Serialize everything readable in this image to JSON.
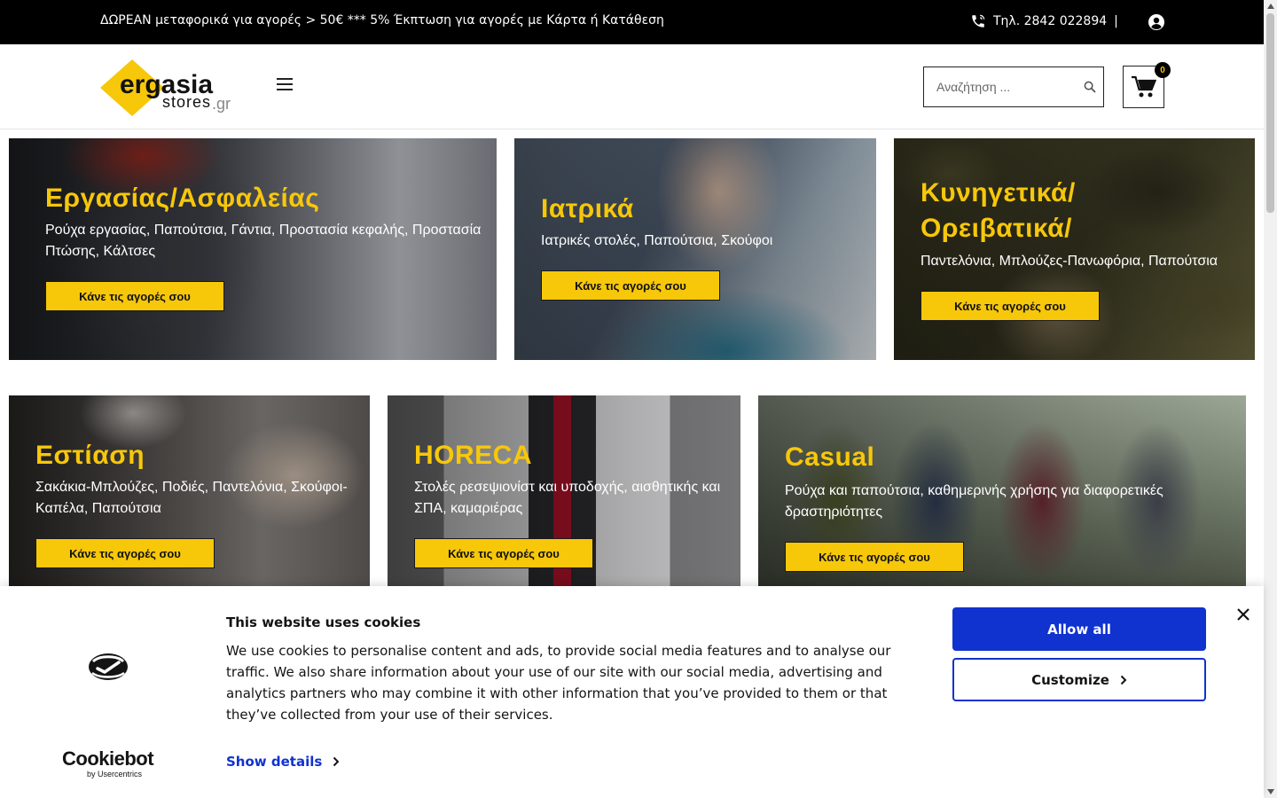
{
  "topbar": {
    "promo": "ΔΩΡΕΑΝ μεταφορικά για αγορές > 50€  ***  5% Έκπτωση για αγορές με Κάρτα ή Κατάθεση",
    "phone": "Τηλ.  2842 022894",
    "separator": "|"
  },
  "header": {
    "logo_main": "ergasia",
    "logo_sub": "stores",
    "logo_tld": ".gr",
    "search_placeholder": "Αναζήτηση ...",
    "cart_count": "0"
  },
  "tiles": [
    {
      "title": "Εργασίας/Ασφαλείας",
      "desc": "Ρούχα εργασίας, Παπούτσια, Γάντια, Προστασία κεφαλής, Προστασία Πτώσης, Κάλτσες",
      "button": "Κάνε τις αγορές σου",
      "colors": [
        "#3b3e44",
        "#8a8d94",
        "#c7392b"
      ]
    },
    {
      "title": "Ιατρικά",
      "desc": "Ιατρικές στολές, Παπούτσια, Σκούφοι",
      "button": "Κάνε τις αγορές σου",
      "colors": [
        "#5b6a7e",
        "#c9b6a8",
        "#2f7d99"
      ]
    },
    {
      "title": "Κυνηγετικά/ Ορειβατικά/",
      "desc": "Παντελόνια, Μπλούζες-Πανωφόρια, Παπούτσια",
      "button": "Κάνε τις αγορές σου",
      "colors": [
        "#4a4a2c",
        "#6e6a3e",
        "#2e2c1c"
      ]
    },
    {
      "title": "Εστίαση",
      "desc": "Σακάκια-Μπλούζες, Ποδιές, Παντελόνια, Σκούφοι-Καπέλα, Παπούτσια",
      "button": "Κάνε τις αγορές σου",
      "colors": [
        "#4c4a48",
        "#8c8784",
        "#d8d2cc"
      ]
    },
    {
      "title": "HORECA",
      "desc": "Στολές ρεσεψιονίστ και υποδοχής, αισθητικής και ΣΠΑ, καμαριέρας",
      "button": "Κάνε τις αγορές σου",
      "colors": [
        "#6e6e70",
        "#2d2d30",
        "#b3122a"
      ]
    },
    {
      "title": "Casual",
      "desc": "Ρούχα και παπούτσια, καθημερινής χρήσης για διαφορετικές δραστηριότητες",
      "button": "Κάνε τις αγορές σου",
      "colors": [
        "#5a6a4a",
        "#8c7a5a",
        "#2a3140"
      ]
    }
  ],
  "cookie": {
    "title": "This website uses cookies",
    "text": "We use cookies to personalise content and ads, to provide social media features and to analyse our traffic. We also share information about your use of our site with our social media, advertising and analytics partners who may combine it with other information that you’ve provided to them or that they’ve collected from your use of their services.",
    "show_details": "Show details",
    "allow_all": "Allow all",
    "customize": "Customize",
    "brand": "Cookiebot",
    "brand_sub": "by Usercentrics",
    "accent": "#1032cf"
  },
  "accent_color": "#f7c70a"
}
